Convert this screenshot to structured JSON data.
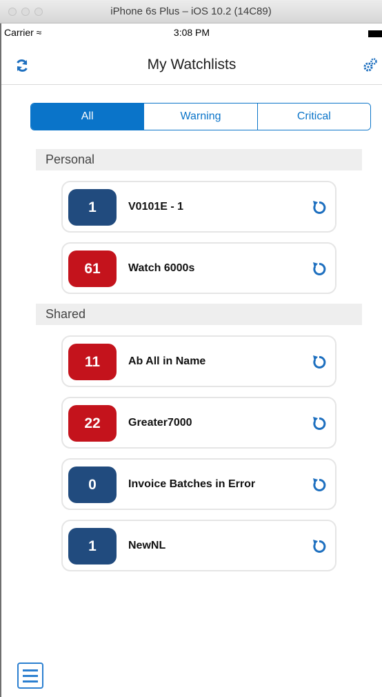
{
  "window": {
    "title": "iPhone 6s Plus – iOS 10.2 (14C89)"
  },
  "status_bar": {
    "carrier": "Carrier",
    "time": "3:08 PM"
  },
  "nav": {
    "title": "My Watchlists",
    "left_icon": "refresh-icon",
    "right_icon": "settings-gears-icon"
  },
  "filter_tabs": [
    {
      "label": "All",
      "selected": true
    },
    {
      "label": "Warning",
      "selected": false
    },
    {
      "label": "Critical",
      "selected": false
    }
  ],
  "sections": [
    {
      "title": "Personal",
      "items": [
        {
          "count": "1",
          "name": "V0101E - 1",
          "color": "#214b7e"
        },
        {
          "count": "61",
          "name": "Watch 6000s",
          "color": "#c4131c"
        }
      ]
    },
    {
      "title": "Shared",
      "items": [
        {
          "count": "11",
          "name": "Ab All in Name",
          "color": "#c4131c"
        },
        {
          "count": "22",
          "name": "Greater7000",
          "color": "#c4131c"
        },
        {
          "count": "0",
          "name": "Invoice Batches in Error",
          "color": "#214b7e"
        },
        {
          "count": "1",
          "name": "NewNL",
          "color": "#214b7e"
        }
      ]
    }
  ],
  "colors": {
    "accent": "#0a74c9",
    "warning_badge": "#214b7e",
    "critical_badge": "#c4131c"
  },
  "menu": {
    "icon": "hamburger-menu-icon"
  }
}
